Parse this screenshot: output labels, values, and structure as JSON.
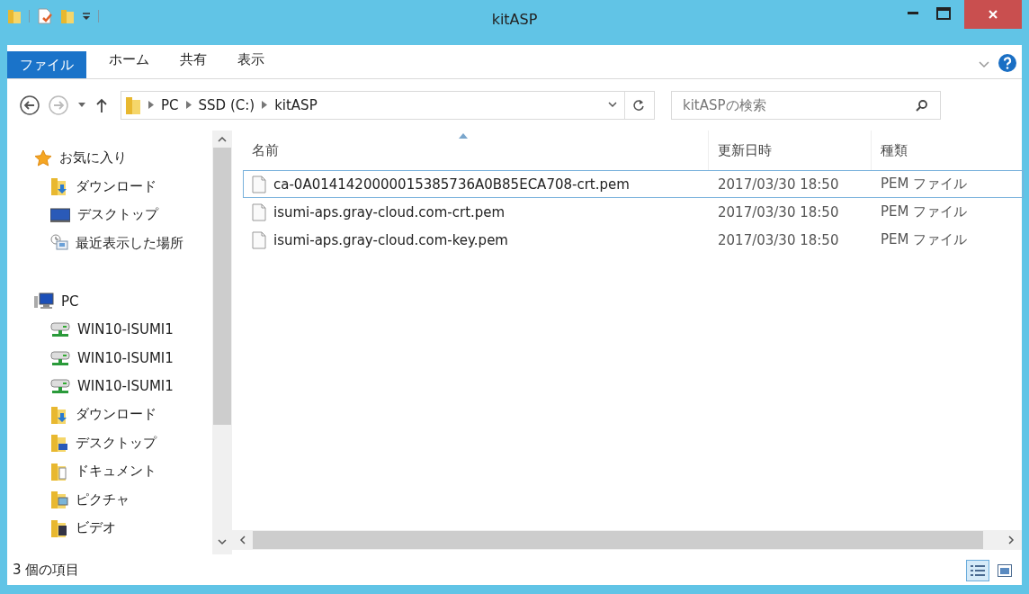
{
  "window": {
    "title": "kitASP"
  },
  "ribbon_tabs": [
    {
      "label": "ファイル",
      "selected": true
    },
    {
      "label": "ホーム",
      "selected": false
    },
    {
      "label": "共有",
      "selected": false
    },
    {
      "label": "表示",
      "selected": false
    }
  ],
  "address": {
    "crumbs": [
      "PC",
      "SSD (C:)",
      "kitASP"
    ]
  },
  "search": {
    "placeholder": "kitASPの検索"
  },
  "sidebar": {
    "groups": [
      {
        "label": "お気に入り",
        "kind": "star",
        "children": [
          {
            "label": "ダウンロード",
            "kind": "download-folder"
          },
          {
            "label": "デスクトップ",
            "kind": "desktop"
          },
          {
            "label": "最近表示した場所",
            "kind": "recent"
          }
        ]
      },
      {
        "label": "PC",
        "kind": "computer",
        "children": [
          {
            "label": "WIN10-ISUMI1",
            "kind": "network-drive"
          },
          {
            "label": "WIN10-ISUMI1",
            "kind": "network-drive"
          },
          {
            "label": "WIN10-ISUMI1",
            "kind": "network-drive"
          },
          {
            "label": "ダウンロード",
            "kind": "download-folder"
          },
          {
            "label": "デスクトップ",
            "kind": "desktop-folder"
          },
          {
            "label": "ドキュメント",
            "kind": "documents-folder"
          },
          {
            "label": "ピクチャ",
            "kind": "pictures-folder"
          },
          {
            "label": "ビデオ",
            "kind": "videos-folder"
          }
        ]
      }
    ]
  },
  "table": {
    "columns": [
      {
        "label": "名前",
        "sorted": true
      },
      {
        "label": "更新日時",
        "sorted": false
      },
      {
        "label": "種類",
        "sorted": false
      }
    ],
    "rows": [
      {
        "name": "ca-0A0141420000015385736A0B85ECA708-crt.pem",
        "modified": "2017/03/30 18:50",
        "type": "PEM ファイル",
        "selected": true
      },
      {
        "name": "isumi-aps.gray-cloud.com-crt.pem",
        "modified": "2017/03/30 18:50",
        "type": "PEM ファイル",
        "selected": false
      },
      {
        "name": "isumi-aps.gray-cloud.com-key.pem",
        "modified": "2017/03/30 18:50",
        "type": "PEM ファイル",
        "selected": false
      }
    ]
  },
  "status_bar": {
    "item_count": "3 個の項目",
    "views": [
      {
        "kind": "details",
        "selected": true
      },
      {
        "kind": "preview",
        "selected": false
      }
    ]
  }
}
